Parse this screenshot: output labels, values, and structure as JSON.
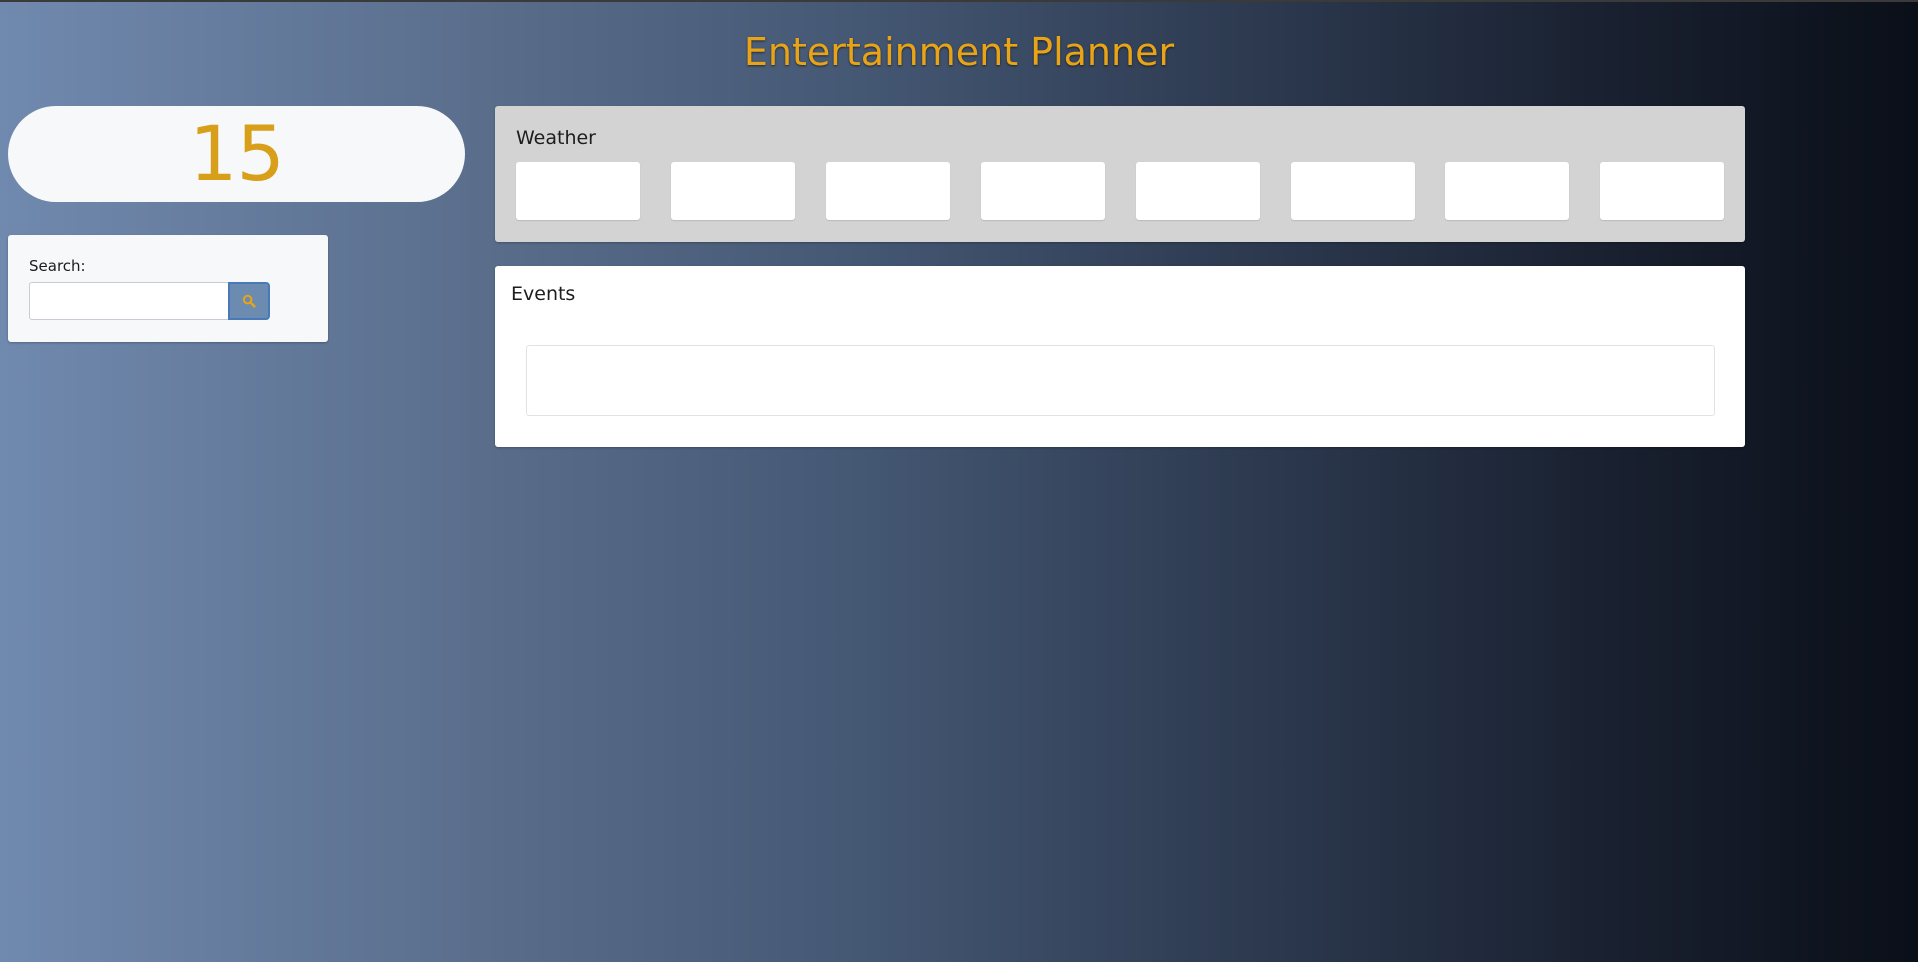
{
  "app": {
    "title": "Entertainment Planner"
  },
  "counter": {
    "value": "15"
  },
  "search": {
    "label": "Search:",
    "value": "",
    "placeholder": "",
    "button_icon": "search-icon"
  },
  "weather": {
    "title": "Weather",
    "days": [
      "",
      "",
      "",
      "",
      "",
      "",
      "",
      ""
    ]
  },
  "events": {
    "title": "Events",
    "items": []
  },
  "colors": {
    "accent": "#e8a416",
    "button": "#6b8bb1",
    "weather_panel": "#d3d3d3"
  }
}
